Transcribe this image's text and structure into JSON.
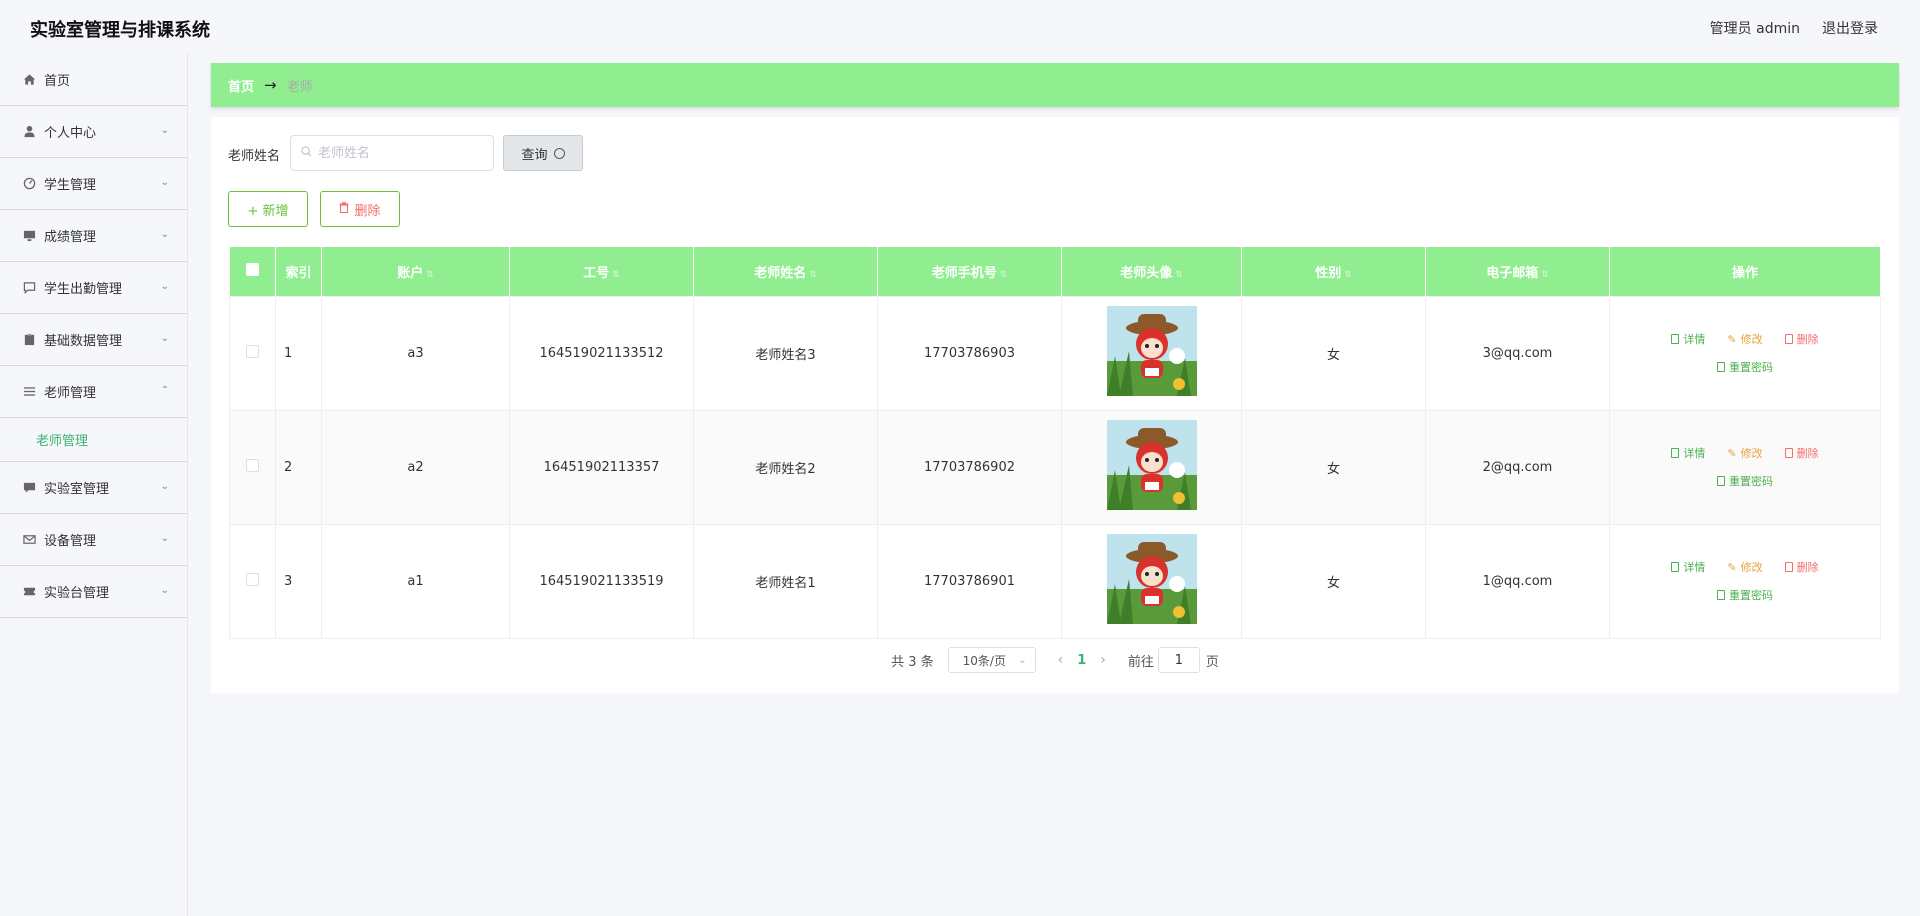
{
  "app": {
    "title": "实验室管理与排课系统",
    "admin_label": "管理员 admin",
    "logout": "退出登录"
  },
  "sidebar": {
    "items": [
      {
        "label": "首页",
        "icon": "home-icon",
        "expandable": false
      },
      {
        "label": "个人中心",
        "icon": "user-icon",
        "expandable": true
      },
      {
        "label": "学生管理",
        "icon": "dashboard-icon",
        "expandable": true
      },
      {
        "label": "成绩管理",
        "icon": "monitor-icon",
        "expandable": true
      },
      {
        "label": "学生出勤管理",
        "icon": "chat-icon",
        "expandable": true
      },
      {
        "label": "基础数据管理",
        "icon": "clipboard-icon",
        "expandable": true
      },
      {
        "label": "老师管理",
        "icon": "list-icon",
        "expandable": true,
        "expanded": true
      },
      {
        "label": "实验室管理",
        "icon": "message-icon",
        "expandable": true
      },
      {
        "label": "设备管理",
        "icon": "mail-icon",
        "expandable": true
      },
      {
        "label": "实验台管理",
        "icon": "ticket-icon",
        "expandable": true
      }
    ],
    "submenu": {
      "label": "老师管理"
    }
  },
  "breadcrumb": {
    "home": "首页",
    "sep": "→",
    "current": "老师"
  },
  "search": {
    "label": "老师姓名",
    "placeholder": "老师姓名",
    "value": "",
    "button": "查询"
  },
  "actions": {
    "add": "+ 新增",
    "delete": "删除"
  },
  "table": {
    "headers": [
      "索引",
      "账户",
      "工号",
      "老师姓名",
      "老师手机号",
      "老师头像",
      "性别",
      "电子邮箱",
      "操作"
    ],
    "rows": [
      {
        "index": "1",
        "account": "a3",
        "job_no": "164519021133512",
        "name": "老师姓名3",
        "phone": "17703786903",
        "gender": "女",
        "email": "3@qq.com"
      },
      {
        "index": "2",
        "account": "a2",
        "job_no": "16451902113357",
        "name": "老师姓名2",
        "phone": "17703786902",
        "gender": "女",
        "email": "2@qq.com"
      },
      {
        "index": "3",
        "account": "a1",
        "job_no": "164519021133519",
        "name": "老师姓名1",
        "phone": "17703786901",
        "gender": "女",
        "email": "1@qq.com"
      }
    ],
    "ops": {
      "detail": "详情",
      "edit": "修改",
      "remove": "删除",
      "reset": "重置密码"
    }
  },
  "pagination": {
    "total": "共 3 条",
    "page_size": "10条/页",
    "current": "1",
    "goto_prefix": "前往",
    "goto_value": "1",
    "goto_suffix": "页"
  },
  "colors": {
    "accent": "#90ee90",
    "primary_text": "#3cb371",
    "danger": "#f56c6c",
    "warning": "#e6a23c"
  }
}
